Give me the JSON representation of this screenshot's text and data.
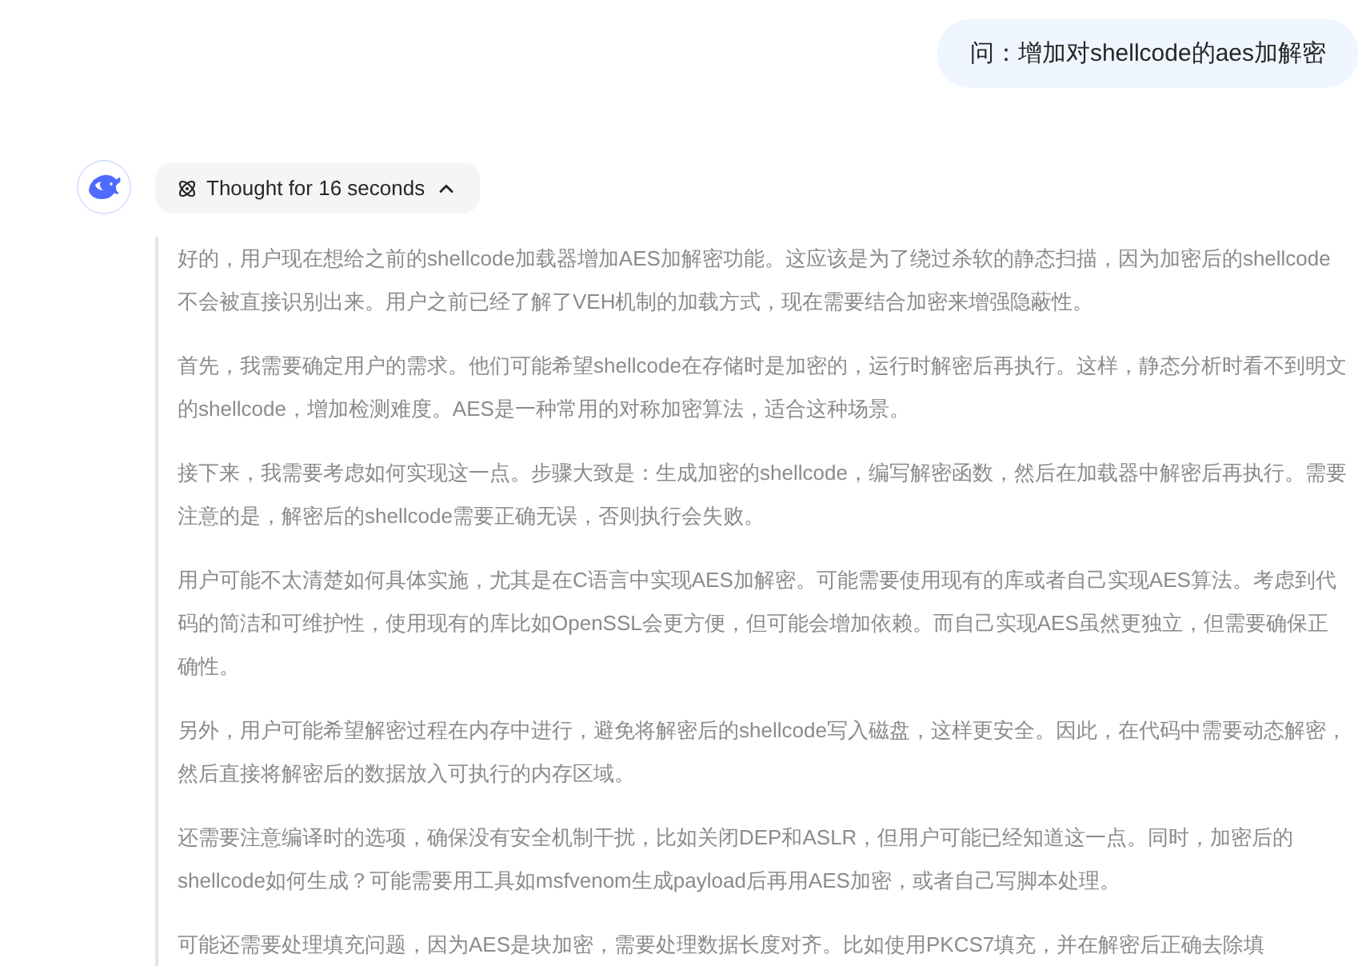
{
  "user_message": {
    "text": "问：增加对shellcode的aes加解密"
  },
  "thought_toggle": {
    "label": "Thought for 16 seconds",
    "expanded": true
  },
  "thinking_paragraphs": [
    "好的，用户现在想给之前的shellcode加载器增加AES加解密功能。这应该是为了绕过杀软的静态扫描，因为加密后的shellcode不会被直接识别出来。用户之前已经了解了VEH机制的加载方式，现在需要结合加密来增强隐蔽性。",
    "首先，我需要确定用户的需求。他们可能希望shellcode在存储时是加密的，运行时解密后再执行。这样，静态分析时看不到明文的shellcode，增加检测难度。AES是一种常用的对称加密算法，适合这种场景。",
    "接下来，我需要考虑如何实现这一点。步骤大致是：生成加密的shellcode，编写解密函数，然后在加载器中解密后再执行。需要注意的是，解密后的shellcode需要正确无误，否则执行会失败。",
    "用户可能不太清楚如何具体实施，尤其是在C语言中实现AES加解密。可能需要使用现有的库或者自己实现AES算法。考虑到代码的简洁和可维护性，使用现有的库比如OpenSSL会更方便，但可能会增加依赖。而自己实现AES虽然更独立，但需要确保正确性。",
    "另外，用户可能希望解密过程在内存中进行，避免将解密后的shellcode写入磁盘，这样更安全。因此，在代码中需要动态解密，然后直接将解密后的数据放入可执行的内存区域。",
    "还需要注意编译时的选项，确保没有安全机制干扰，比如关闭DEP和ASLR，但用户可能已经知道这一点。同时，加密后的shellcode如何生成？可能需要用工具如msfvenom生成payload后再用AES加密，或者自己写脚本处理。",
    "可能还需要处理填充问题，因为AES是块加密，需要处理数据长度对齐。比如使用PKCS7填充，并在解密后正确去除填"
  ]
}
